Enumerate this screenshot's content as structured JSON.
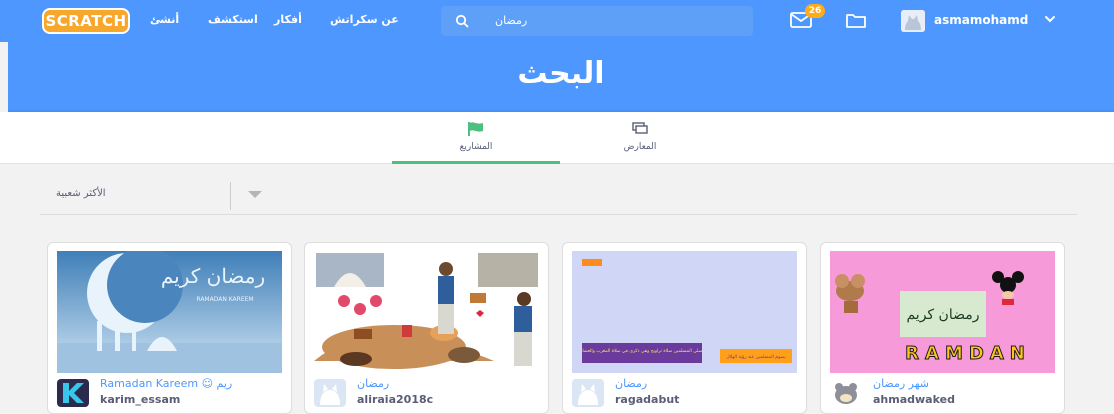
{
  "nav": {
    "logo": "SCRATCH",
    "links": [
      "أنشئ",
      "استكشف",
      "أفكار",
      "عن سكراتش"
    ],
    "search_value": "رمضان",
    "messages_count": "26",
    "username": "asmamohamd"
  },
  "banner": {
    "title": "البحث"
  },
  "tabs": [
    {
      "label": "المشاريع",
      "icon": "flag-icon",
      "active": true
    },
    {
      "label": "المعارض",
      "icon": "studio-icon",
      "active": false
    }
  ],
  "filter": {
    "selected": "الأكثر شعبية"
  },
  "cards": [
    {
      "title": "Ramadan Kareem ☺ ريم",
      "author": "karim_essam"
    },
    {
      "title": "رمضان",
      "author": "aliraia2018c"
    },
    {
      "title": "رمضان",
      "author": "ragadabut"
    },
    {
      "title": "شهر رمضان",
      "author": "ahmadwaked"
    }
  ],
  "thumbnails": {
    "card1": {
      "script": "رمضان كريم",
      "caption": "RAMADAN KAREEM"
    },
    "card3": {
      "left_box": "يصلي المسلمين صلاة تراويح وهي ذكرى في صلاة المغرب والعشاء",
      "right_box": "يصوم المسلمين عند رؤية الهلال"
    },
    "card4": {
      "script": "رمضان كريم",
      "word": "RAMDAN"
    }
  },
  "colors": {
    "brand": "#4d97ff",
    "active_tab": "#4dbf7f",
    "badge": "#ffab1a",
    "logo": "#f7a72b"
  }
}
